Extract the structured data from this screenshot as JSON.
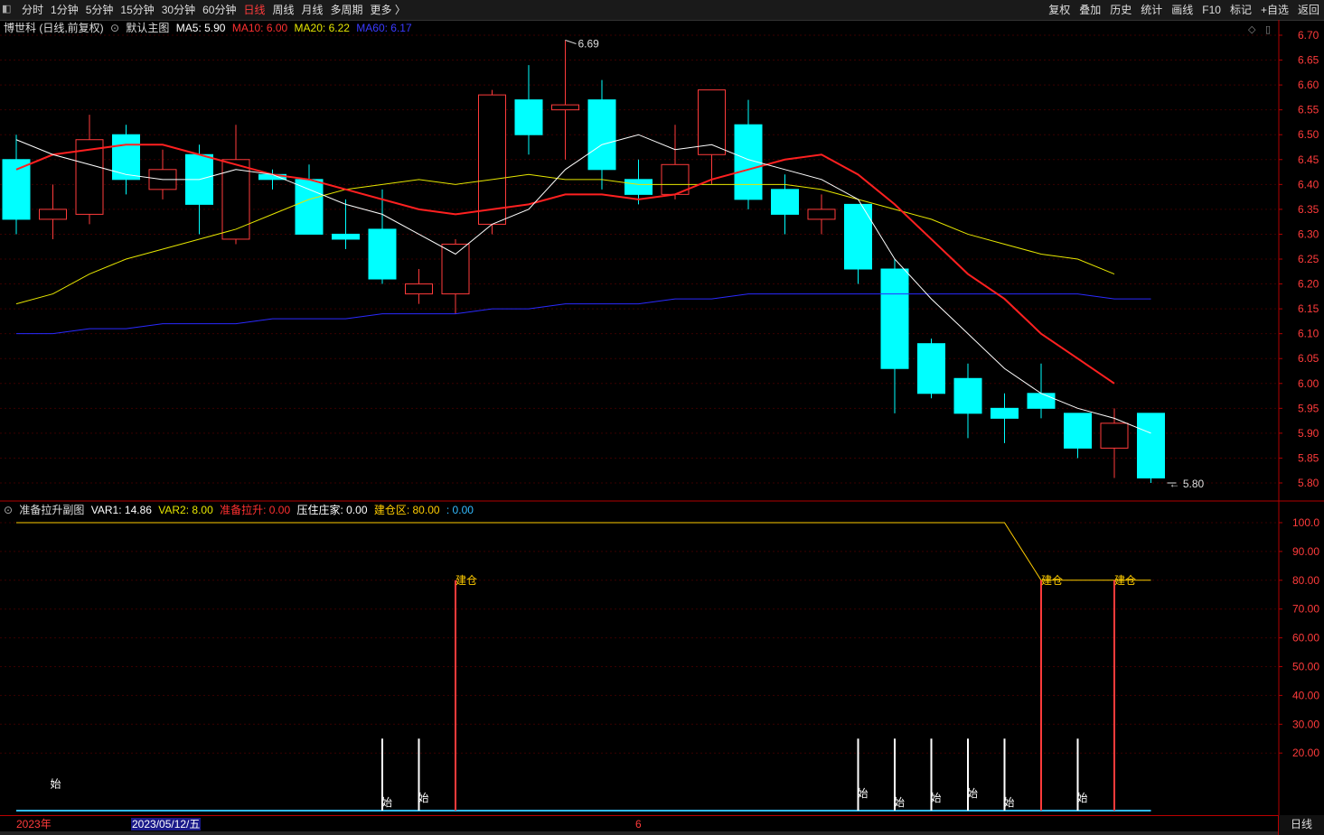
{
  "toolbar": {
    "periods": [
      "分时",
      "1分钟",
      "5分钟",
      "15分钟",
      "30分钟",
      "60分钟",
      "日线",
      "周线",
      "月线",
      "多周期",
      "更多 〉"
    ],
    "active_period": "日线",
    "tools": [
      "复权",
      "叠加",
      "历史",
      "统计",
      "画线",
      "F10",
      "标记",
      "+自选",
      "返回"
    ]
  },
  "main_info": {
    "stock": "博世科 (日线,前复权)",
    "template": "默认主图",
    "ma5": "MA5: 5.90",
    "ma10": "MA10: 6.00",
    "ma20": "MA20: 6.22",
    "ma60": "MA60: 6.17"
  },
  "sub_info": {
    "name": "准备拉升副图",
    "var1": "VAR1: 14.86",
    "var2": "VAR2: 8.00",
    "zbls": "准备拉升: 0.00",
    "yzzj": "压住庄家: 0.00",
    "jcq": "建仓区: 80.00",
    "extra": ": 0.00"
  },
  "main_axis": [
    "6.70",
    "6.65",
    "6.60",
    "6.55",
    "6.50",
    "6.45",
    "6.40",
    "6.35",
    "6.30",
    "6.25",
    "6.20",
    "6.15",
    "6.10",
    "6.05",
    "6.00",
    "5.95",
    "5.90",
    "5.85",
    "5.80"
  ],
  "sub_axis": [
    "100.0",
    "90.00",
    "80.00",
    "70.00",
    "60.00",
    "50.00",
    "40.00",
    "30.00",
    "20.00"
  ],
  "high_label": "6.69",
  "low_label": "5.80",
  "sub_label_jc": "建仓",
  "sub_label_shi": "始",
  "bottom": {
    "year": "2023年",
    "cursor_date": "2023/05/12/五",
    "month_mark": "6",
    "period_button": "日线"
  },
  "colors": {
    "up": "#ff3b3b",
    "down": "#00ffff",
    "ma5": "#ffffff",
    "ma10": "#ff2020",
    "ma20": "#e6e600",
    "ma60": "#2a2aff",
    "accent": "#ffcc00"
  },
  "chart_data": {
    "type": "candlestick",
    "title": "",
    "ylim": [
      5.8,
      6.7
    ],
    "candles": [
      {
        "o": 6.45,
        "h": 6.5,
        "l": 6.3,
        "c": 6.33
      },
      {
        "o": 6.33,
        "h": 6.4,
        "l": 6.29,
        "c": 6.35
      },
      {
        "o": 6.34,
        "h": 6.54,
        "l": 6.32,
        "c": 6.49
      },
      {
        "o": 6.5,
        "h": 6.52,
        "l": 6.38,
        "c": 6.41
      },
      {
        "o": 6.39,
        "h": 6.47,
        "l": 6.37,
        "c": 6.43
      },
      {
        "o": 6.46,
        "h": 6.48,
        "l": 6.3,
        "c": 6.36
      },
      {
        "o": 6.29,
        "h": 6.52,
        "l": 6.28,
        "c": 6.45
      },
      {
        "o": 6.42,
        "h": 6.43,
        "l": 6.39,
        "c": 6.41
      },
      {
        "o": 6.41,
        "h": 6.44,
        "l": 6.3,
        "c": 6.3
      },
      {
        "o": 6.3,
        "h": 6.37,
        "l": 6.27,
        "c": 6.29
      },
      {
        "o": 6.31,
        "h": 6.39,
        "l": 6.2,
        "c": 6.21
      },
      {
        "o": 6.18,
        "h": 6.23,
        "l": 6.16,
        "c": 6.2
      },
      {
        "o": 6.18,
        "h": 6.29,
        "l": 6.14,
        "c": 6.28
      },
      {
        "o": 6.32,
        "h": 6.59,
        "l": 6.3,
        "c": 6.58
      },
      {
        "o": 6.57,
        "h": 6.64,
        "l": 6.46,
        "c": 6.5
      },
      {
        "o": 6.55,
        "h": 6.69,
        "l": 6.45,
        "c": 6.56
      },
      {
        "o": 6.57,
        "h": 6.61,
        "l": 6.39,
        "c": 6.43
      },
      {
        "o": 6.41,
        "h": 6.45,
        "l": 6.36,
        "c": 6.38
      },
      {
        "o": 6.38,
        "h": 6.52,
        "l": 6.37,
        "c": 6.44
      },
      {
        "o": 6.46,
        "h": 6.59,
        "l": 6.4,
        "c": 6.59
      },
      {
        "o": 6.52,
        "h": 6.57,
        "l": 6.35,
        "c": 6.37
      },
      {
        "o": 6.39,
        "h": 6.42,
        "l": 6.3,
        "c": 6.34
      },
      {
        "o": 6.33,
        "h": 6.38,
        "l": 6.3,
        "c": 6.35
      },
      {
        "o": 6.36,
        "h": 6.36,
        "l": 6.2,
        "c": 6.23
      },
      {
        "o": 6.23,
        "h": 6.25,
        "l": 5.94,
        "c": 6.03
      },
      {
        "o": 6.08,
        "h": 6.09,
        "l": 5.97,
        "c": 5.98
      },
      {
        "o": 6.01,
        "h": 6.04,
        "l": 5.89,
        "c": 5.94
      },
      {
        "o": 5.95,
        "h": 5.98,
        "l": 5.88,
        "c": 5.93
      },
      {
        "o": 5.98,
        "h": 6.04,
        "l": 5.93,
        "c": 5.95
      },
      {
        "o": 5.94,
        "h": 5.94,
        "l": 5.85,
        "c": 5.87
      },
      {
        "o": 5.87,
        "h": 5.95,
        "l": 5.81,
        "c": 5.92
      },
      {
        "o": 5.94,
        "h": 5.94,
        "l": 5.8,
        "c": 5.81
      }
    ],
    "ma5": [
      6.49,
      6.46,
      6.44,
      6.42,
      6.41,
      6.41,
      6.43,
      6.42,
      6.39,
      6.36,
      6.34,
      6.3,
      6.26,
      6.32,
      6.35,
      6.43,
      6.48,
      6.5,
      6.47,
      6.48,
      6.45,
      6.43,
      6.41,
      6.37,
      6.25,
      6.17,
      6.1,
      6.03,
      5.98,
      5.95,
      5.93,
      5.9
    ],
    "ma10": [
      6.43,
      6.46,
      6.47,
      6.48,
      6.48,
      6.46,
      6.44,
      6.42,
      6.41,
      6.39,
      6.37,
      6.35,
      6.34,
      6.35,
      6.36,
      6.38,
      6.38,
      6.37,
      6.38,
      6.41,
      6.43,
      6.45,
      6.46,
      6.42,
      6.36,
      6.29,
      6.22,
      6.17,
      6.1,
      6.05,
      6.0
    ],
    "ma20": [
      6.16,
      6.18,
      6.22,
      6.25,
      6.27,
      6.29,
      6.31,
      6.34,
      6.37,
      6.39,
      6.4,
      6.41,
      6.4,
      6.41,
      6.42,
      6.41,
      6.41,
      6.4,
      6.4,
      6.4,
      6.4,
      6.4,
      6.39,
      6.37,
      6.35,
      6.33,
      6.3,
      6.28,
      6.26,
      6.25,
      6.22
    ],
    "ma60": [
      6.1,
      6.1,
      6.11,
      6.11,
      6.12,
      6.12,
      6.12,
      6.13,
      6.13,
      6.13,
      6.14,
      6.14,
      6.14,
      6.15,
      6.15,
      6.16,
      6.16,
      6.16,
      6.17,
      6.17,
      6.18,
      6.18,
      6.18,
      6.18,
      6.18,
      6.18,
      6.18,
      6.18,
      6.18,
      6.18,
      6.17,
      6.17
    ],
    "sub": {
      "ylim": [
        0,
        105
      ],
      "jcq_line": [
        100,
        100,
        100,
        100,
        100,
        100,
        100,
        100,
        100,
        100,
        100,
        100,
        100,
        100,
        100,
        100,
        100,
        100,
        100,
        100,
        100,
        100,
        100,
        100,
        100,
        100,
        100,
        100,
        80,
        80,
        80,
        80
      ],
      "jc_bars": [
        12,
        28,
        30
      ],
      "shi_bars": [
        10,
        11,
        23,
        24,
        25,
        26,
        27,
        29
      ],
      "shi_low_at": [
        1
      ]
    }
  }
}
